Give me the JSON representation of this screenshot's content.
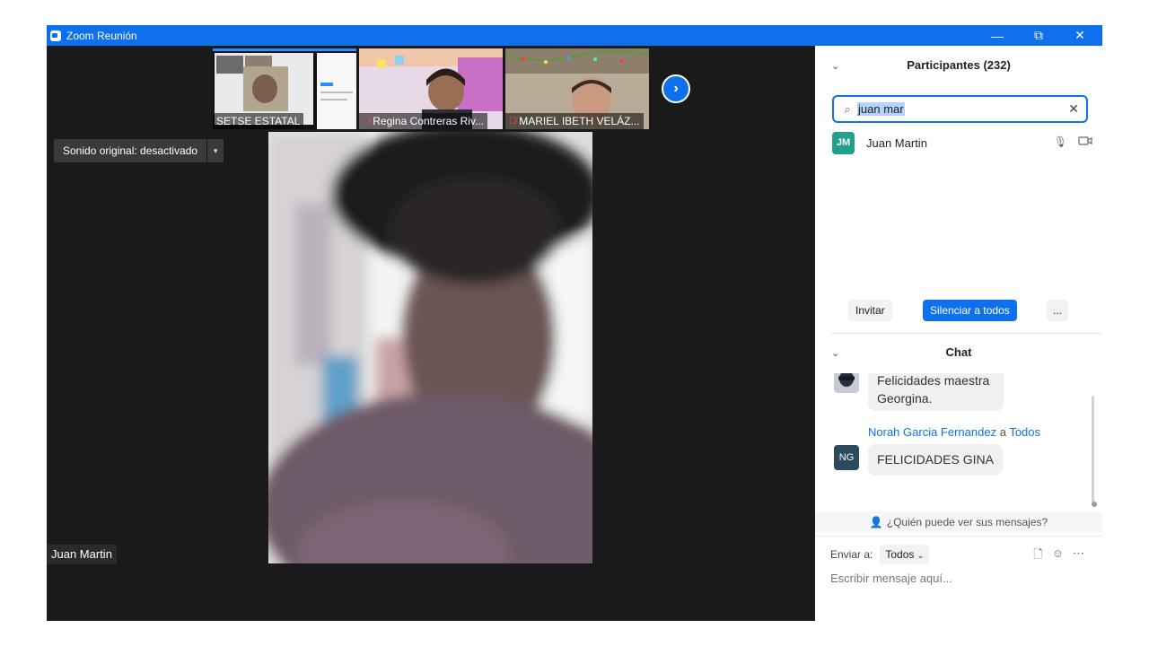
{
  "window": {
    "title": "Zoom Reunión",
    "minimize": "—",
    "restore": "⧉",
    "close": "✕"
  },
  "thumbnails": [
    {
      "name": "SETSE ESTATAL",
      "muted": false
    },
    {
      "name": "Regina Contreras Riv...",
      "muted": true
    },
    {
      "name": "MARIEL IBETH VELÁZ...",
      "muted": true
    }
  ],
  "next_button_icon": "chevron-right-icon",
  "sound_control": {
    "label": "Sonido original: desactivado",
    "dropdown": "▾"
  },
  "active_speaker": {
    "name": "Juan Martin"
  },
  "participants": {
    "title": "Participantes (232)",
    "search_value": "juan mar",
    "list": [
      {
        "initials": "JM",
        "name": "Juan Martin",
        "avatar_color": "#23a08a"
      }
    ],
    "buttons": {
      "invite": "Invitar",
      "mute_all": "Silenciar a todos",
      "more": "..."
    }
  },
  "chat": {
    "title": "Chat",
    "messages": [
      {
        "text_line1": "Felicidades maestra",
        "text_line2": "Georgina."
      },
      {
        "sender": "Norah Garcia Fernandez",
        "connector": "a",
        "recipient": "Todos",
        "avatar": "NG",
        "text": "FELICIDADES GINA"
      }
    ],
    "who_can_see": "¿Quién puede ver sus mensajes?",
    "send_to_label": "Enviar a:",
    "send_to_value": "Todos",
    "input_placeholder": "Escribir mensaje aquí..."
  },
  "colors": {
    "accent": "#0e71eb",
    "stage_bg": "#1a1a1a",
    "avatar_jm": "#23a08a",
    "avatar_ng": "#2d4a5e"
  }
}
